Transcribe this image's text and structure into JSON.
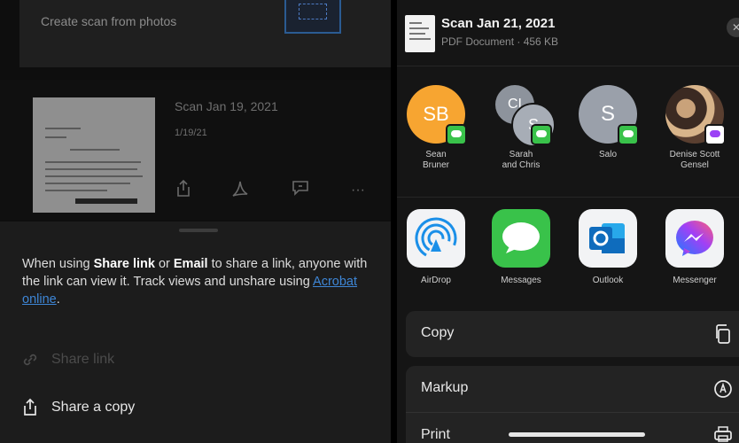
{
  "left": {
    "create_card": {
      "label": "Create scan from photos"
    },
    "scan": {
      "title": "Scan Jan 19, 2021",
      "date": "1/19/21"
    },
    "sheet": {
      "note_prefix": "When using ",
      "note_share": "Share link",
      "note_or": " or ",
      "note_email": "Email",
      "note_middle": " to share a link, anyone with the link can view it. Track views and unshare using ",
      "note_link": "Acrobat online",
      "note_end": ".",
      "share_link_label": "Share link",
      "share_copy_label": "Share a copy"
    }
  },
  "right": {
    "header": {
      "title": "Scan Jan 21, 2021",
      "subtitle": "PDF Document · 456 KB"
    },
    "people": [
      {
        "name": "Sean\nBruner",
        "initials": "SB",
        "color": "#f7a531"
      },
      {
        "name": "Sarah\nand Chris",
        "initials_back": "CI",
        "initials_front": "S",
        "color": "#9aa0aa"
      },
      {
        "name": "Salo",
        "initials": "S",
        "color": "#9aa0aa"
      },
      {
        "name": "Denise Scott\nGensel",
        "initials": "",
        "color": "#6b4a3a"
      }
    ],
    "apps": [
      {
        "name": "AirDrop"
      },
      {
        "name": "Messages"
      },
      {
        "name": "Outlook"
      },
      {
        "name": "Messenger"
      }
    ],
    "actions": [
      {
        "label": "Copy"
      },
      {
        "label": "Markup"
      },
      {
        "label": "Print"
      }
    ]
  },
  "colors": {
    "link_blue": "#3e86d6",
    "messages_green": "#39c24a",
    "outlook_blue": "#0f6cbd",
    "sheet_bg": "#1c1c1c"
  }
}
